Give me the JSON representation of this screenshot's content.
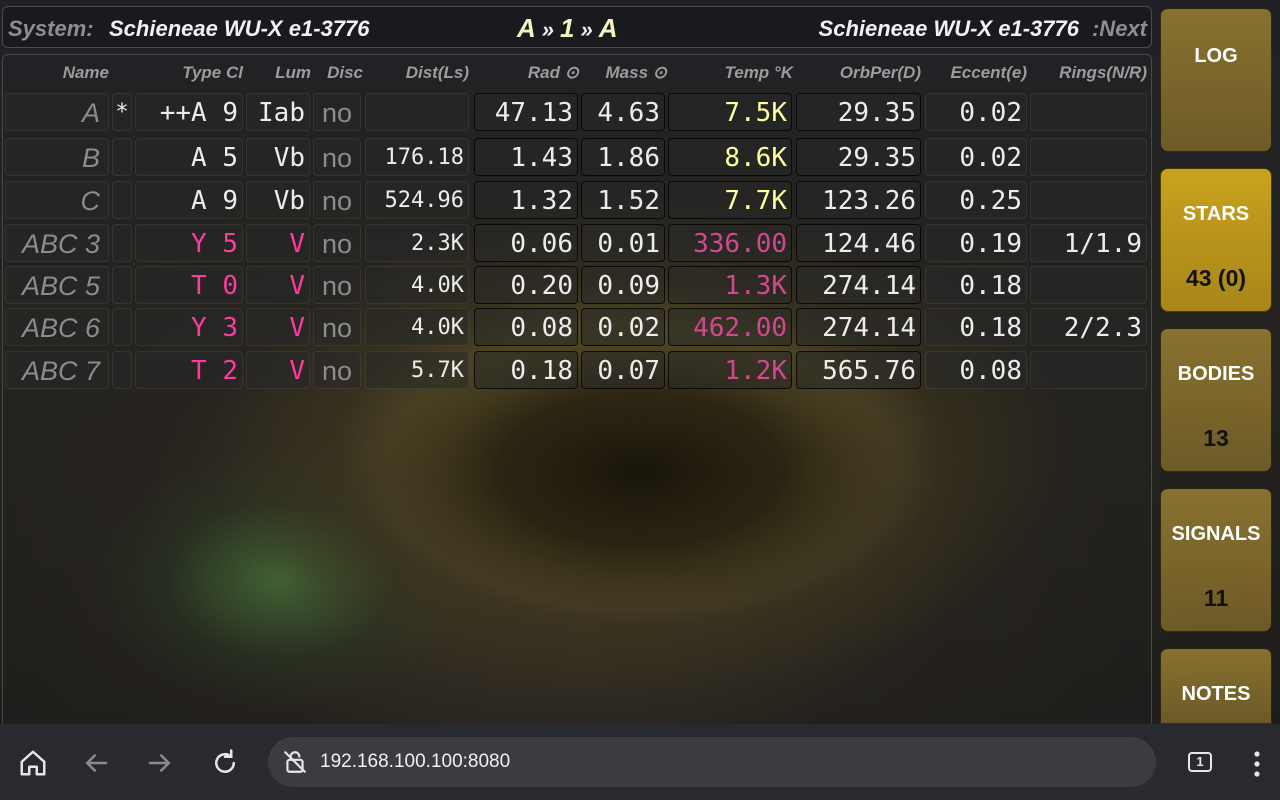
{
  "header": {
    "system_label": "System:",
    "system_name": "Schieneae WU-X e1-3776",
    "nav_left": "A",
    "nav_sep_left": "»",
    "nav_index": "1",
    "nav_sep_right": "»",
    "nav_right": "A",
    "next_name": "Schieneae WU-X e1-3776",
    "next_label": ":Next"
  },
  "columns": {
    "name": "Name",
    "type_cl": "Type Cl",
    "lum": "Lum",
    "disc": "Disc",
    "dist": "Dist(Ls)",
    "rad": "Rad ⊙",
    "mass": "Mass ⊙",
    "temp": "Temp °K",
    "orbper": "OrbPer(D)",
    "eccent": "Eccent(e)",
    "rings": "Rings(N/R)"
  },
  "rows": [
    {
      "name": "A",
      "star": "*",
      "type": "++A 9",
      "lum": "Iab",
      "disc": "no",
      "dist": "",
      "rad": "47.13",
      "mass": "4.63",
      "temp": "7.5K",
      "orbper": "29.35",
      "eccent": "0.02",
      "rings": ""
    },
    {
      "name": "B",
      "star": "",
      "type": "A 5",
      "lum": "Vb",
      "disc": "no",
      "dist": "176.18",
      "rad": "1.43",
      "mass": "1.86",
      "temp": "8.6K",
      "orbper": "29.35",
      "eccent": "0.02",
      "rings": ""
    },
    {
      "name": "C",
      "star": "",
      "type": "A 9",
      "lum": "Vb",
      "disc": "no",
      "dist": "524.96",
      "rad": "1.32",
      "mass": "1.52",
      "temp": "7.7K",
      "orbper": "123.26",
      "eccent": "0.25",
      "rings": ""
    },
    {
      "name": "ABC 3",
      "star": "",
      "type": "Y 5",
      "lum": "V",
      "disc": "no",
      "dist": "2.3K",
      "rad": "0.06",
      "mass": "0.01",
      "temp": "336.00",
      "orbper": "124.46",
      "eccent": "0.19",
      "rings": "1/1.9"
    },
    {
      "name": "ABC 5",
      "star": "",
      "type": "T 0",
      "lum": "V",
      "disc": "no",
      "dist": "4.0K",
      "rad": "0.20",
      "mass": "0.09",
      "temp": "1.3K",
      "orbper": "274.14",
      "eccent": "0.18",
      "rings": ""
    },
    {
      "name": "ABC 6",
      "star": "",
      "type": "Y 3",
      "lum": "V",
      "disc": "no",
      "dist": "4.0K",
      "rad": "0.08",
      "mass": "0.02",
      "temp": "462.00",
      "orbper": "274.14",
      "eccent": "0.18",
      "rings": "2/2.3"
    },
    {
      "name": "ABC 7",
      "star": "",
      "type": "T 2",
      "lum": "V",
      "disc": "no",
      "dist": "5.7K",
      "rad": "0.18",
      "mass": "0.07",
      "temp": "1.2K",
      "orbper": "565.76",
      "eccent": "0.08",
      "rings": ""
    }
  ],
  "tabs": [
    {
      "label": "LOG",
      "count": ""
    },
    {
      "label": "STARS",
      "count": "43 (0)"
    },
    {
      "label": "BODIES",
      "count": "13"
    },
    {
      "label": "SIGNALS",
      "count": "11"
    },
    {
      "label": "NOTES",
      "count": ""
    }
  ],
  "browser": {
    "url": "192.168.100.100:8080",
    "tab_count": "1"
  },
  "colors": {
    "yellow_text": "#ffff9e",
    "pink_text": "#ff3aa0",
    "tab_gold": "#c9a21e",
    "tab_bronze": "#8f7630"
  }
}
